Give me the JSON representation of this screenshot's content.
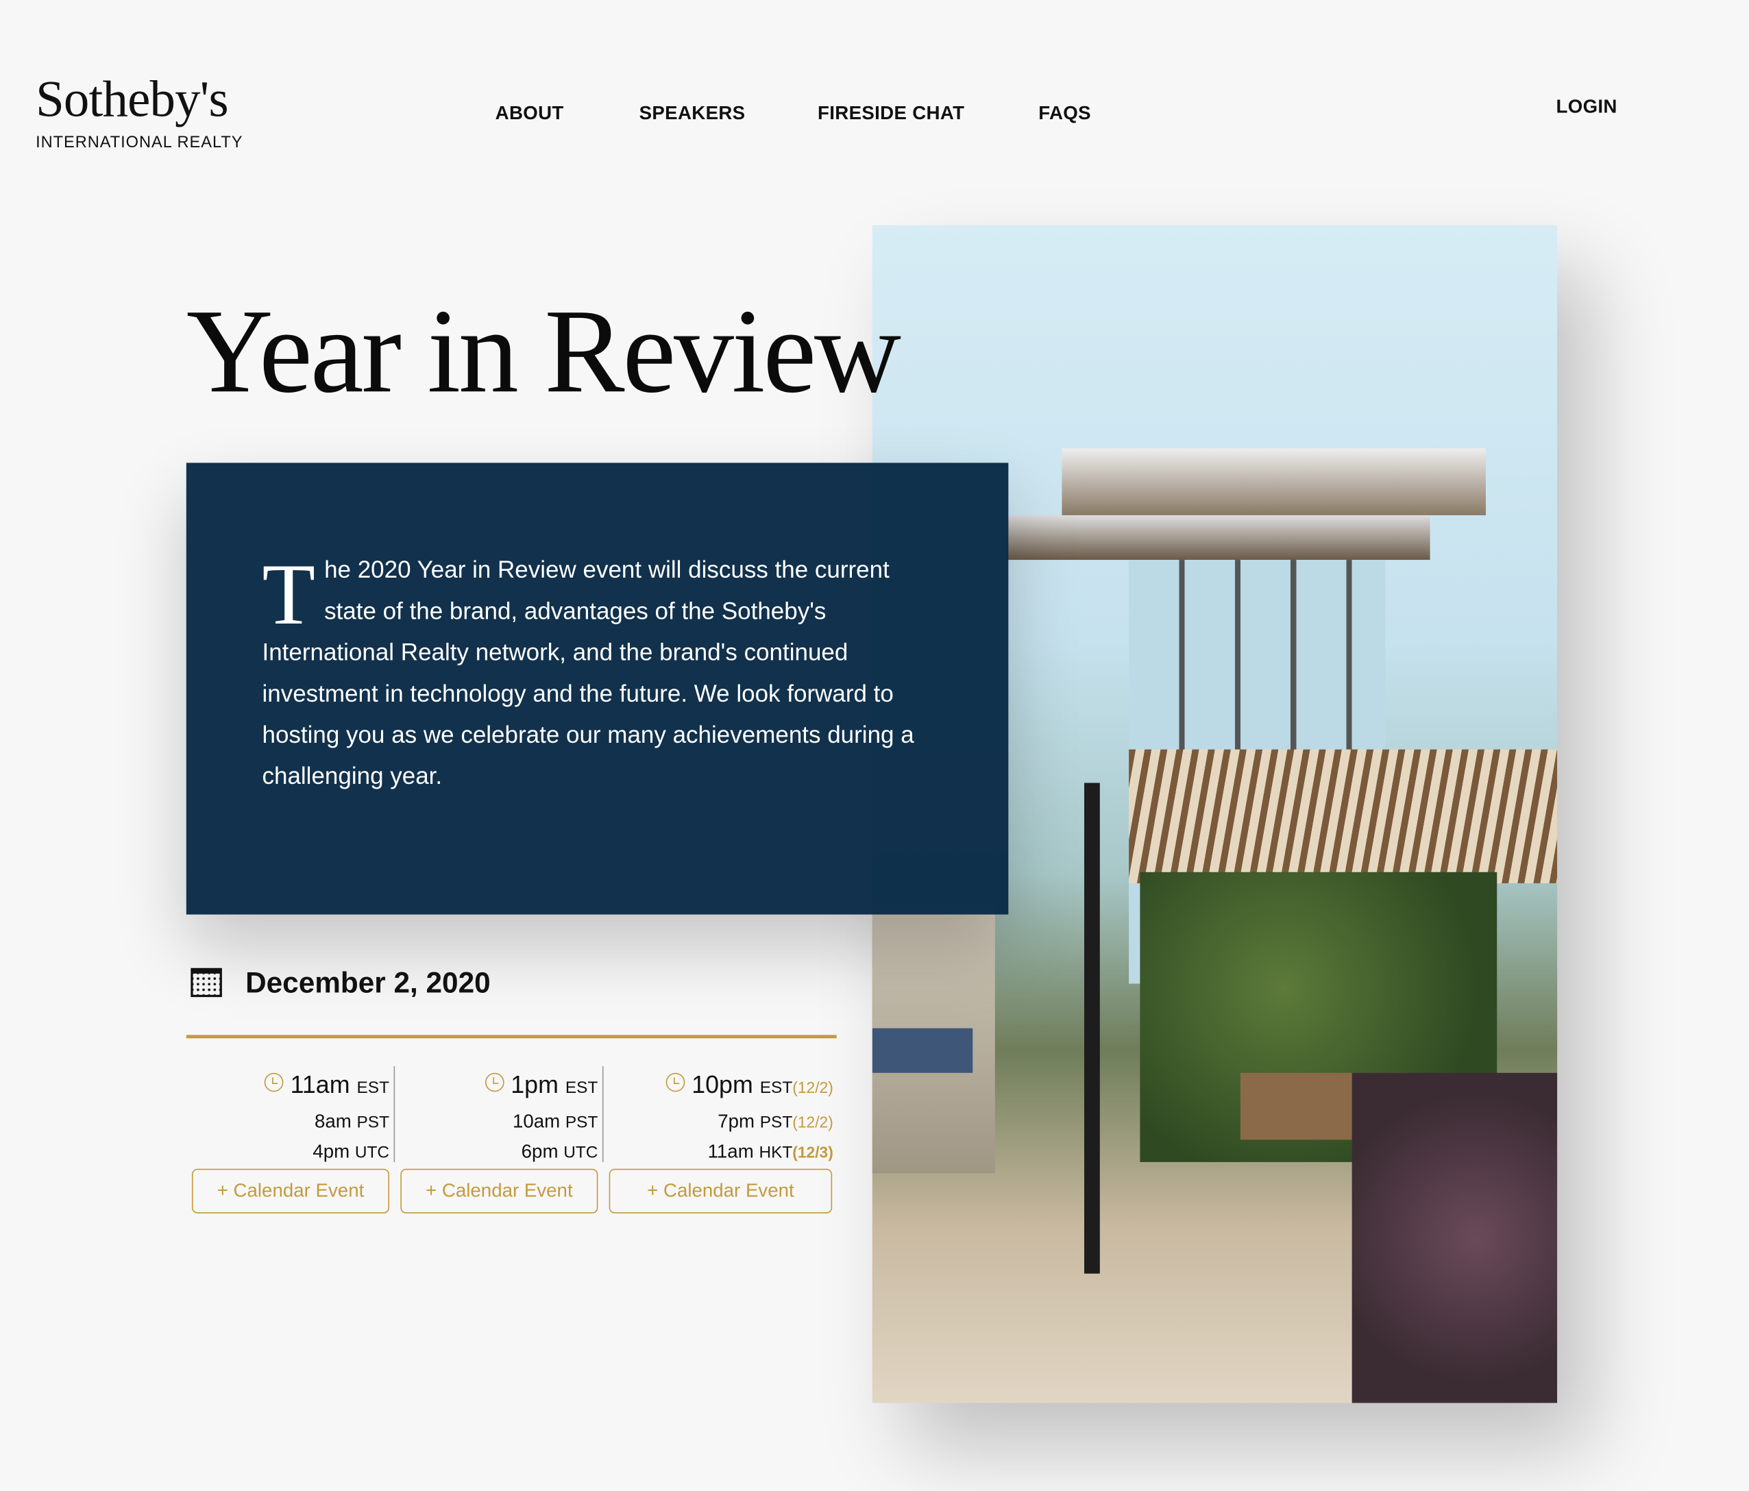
{
  "brand": {
    "name": "Sotheby's",
    "subtitle": "INTERNATIONAL REALTY"
  },
  "nav": {
    "items": [
      "ABOUT",
      "SPEAKERS",
      "FIRESIDE CHAT",
      "FAQS"
    ],
    "login": "LOGIN"
  },
  "hero": {
    "title": "Year in Review",
    "dropcap": "T",
    "body": "he 2020 Year in Review event will discuss the current state of the brand, advantages of the Sotheby's International Realty network, and the brand's continued investment in technology and the future. We look forward to hosting you as we celebrate our many achievements during a challenging year.",
    "image": "modern-patio-pergola-photo"
  },
  "event": {
    "date": "December 2, 2020",
    "icon": "calendar-icon",
    "sessions": [
      {
        "l1": {
          "t": "11am",
          "z": "EST",
          "d": ""
        },
        "l2": {
          "t": "8am",
          "z": "PST",
          "d": ""
        },
        "l3": {
          "t": "4pm",
          "z": "UTC",
          "d": ""
        },
        "button": "+ Calendar Event"
      },
      {
        "l1": {
          "t": "1pm",
          "z": "EST",
          "d": ""
        },
        "l2": {
          "t": "10am",
          "z": "PST",
          "d": ""
        },
        "l3": {
          "t": "6pm",
          "z": "UTC",
          "d": ""
        },
        "button": "+ Calendar Event"
      },
      {
        "l1": {
          "t": "10pm",
          "z": "EST",
          "d": "(12/2)"
        },
        "l2": {
          "t": "7pm",
          "z": "PST",
          "d": "(12/2)"
        },
        "l3": {
          "t": "11am",
          "z": "HKT",
          "d": "(12/3)"
        },
        "button": "+ Calendar Event"
      }
    ]
  },
  "colors": {
    "navy": "#0c2d48",
    "gold": "#c49a3d",
    "background": "#f7f7f7"
  }
}
